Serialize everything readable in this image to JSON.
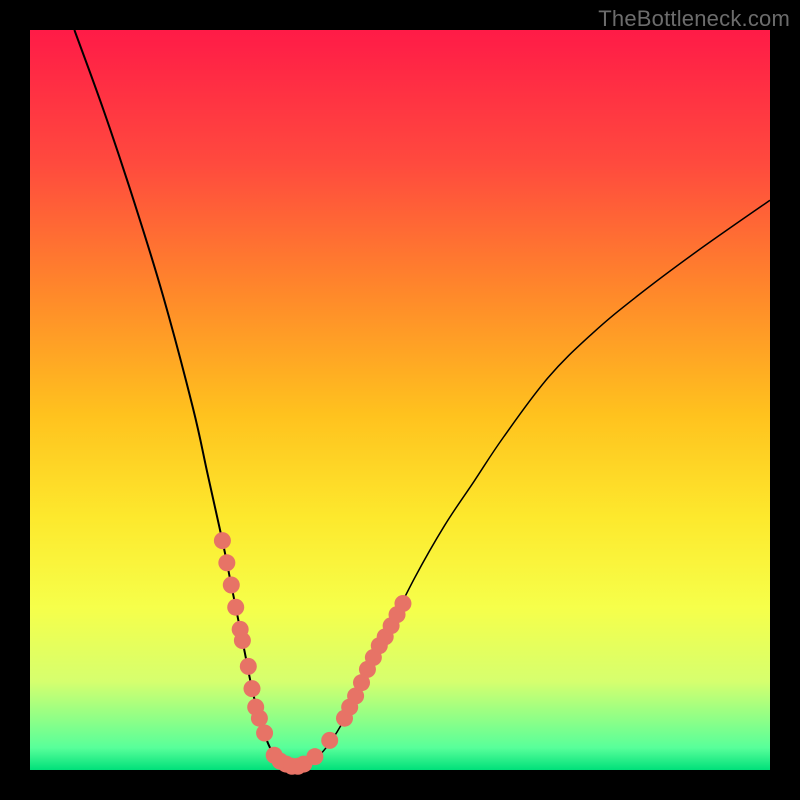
{
  "watermark": "TheBottleneck.com",
  "colors": {
    "gradient_top": "#ff1b47",
    "gradient_bottom": "#00e07a",
    "marker": "#e77366",
    "curve": "#000000",
    "frame": "#000000"
  },
  "chart_data": {
    "type": "line",
    "title": "",
    "xlabel": "",
    "ylabel": "",
    "xlim": [
      0,
      100
    ],
    "ylim": [
      0,
      100
    ],
    "grid": false,
    "legend": false,
    "series": [
      {
        "name": "bottleneck-curve",
        "x": [
          6,
          10,
          14,
          18,
          22,
          24,
          26,
          27,
          28,
          29,
          30,
          31,
          32,
          33,
          34,
          35,
          36,
          38,
          40,
          42,
          44,
          48,
          52,
          56,
          60,
          64,
          70,
          76,
          82,
          90,
          100
        ],
        "y": [
          100,
          89,
          77,
          64,
          49,
          40,
          31,
          26,
          21,
          16,
          11,
          7,
          4,
          2,
          1,
          0.5,
          0.5,
          1,
          3,
          6,
          10,
          18,
          26,
          33,
          39,
          45,
          53,
          59,
          64,
          70,
          77
        ]
      }
    ],
    "markers": {
      "name": "highlighted-points",
      "points": [
        {
          "x": 26.0,
          "y": 31
        },
        {
          "x": 26.6,
          "y": 28
        },
        {
          "x": 27.2,
          "y": 25
        },
        {
          "x": 27.8,
          "y": 22
        },
        {
          "x": 28.4,
          "y": 19
        },
        {
          "x": 28.7,
          "y": 17.5
        },
        {
          "x": 29.5,
          "y": 14
        },
        {
          "x": 30.0,
          "y": 11
        },
        {
          "x": 30.5,
          "y": 8.5
        },
        {
          "x": 31.0,
          "y": 7
        },
        {
          "x": 31.7,
          "y": 5
        },
        {
          "x": 33.0,
          "y": 2
        },
        {
          "x": 33.8,
          "y": 1.2
        },
        {
          "x": 34.6,
          "y": 0.8
        },
        {
          "x": 35.4,
          "y": 0.5
        },
        {
          "x": 36.2,
          "y": 0.5
        },
        {
          "x": 37.0,
          "y": 0.8
        },
        {
          "x": 38.5,
          "y": 1.8
        },
        {
          "x": 40.5,
          "y": 4
        },
        {
          "x": 42.5,
          "y": 7
        },
        {
          "x": 43.2,
          "y": 8.5
        },
        {
          "x": 44.0,
          "y": 10
        },
        {
          "x": 44.8,
          "y": 11.8
        },
        {
          "x": 45.6,
          "y": 13.6
        },
        {
          "x": 46.4,
          "y": 15.2
        },
        {
          "x": 47.2,
          "y": 16.8
        },
        {
          "x": 48.0,
          "y": 18
        },
        {
          "x": 48.8,
          "y": 19.5
        },
        {
          "x": 49.6,
          "y": 21
        },
        {
          "x": 50.4,
          "y": 22.5
        }
      ]
    }
  }
}
